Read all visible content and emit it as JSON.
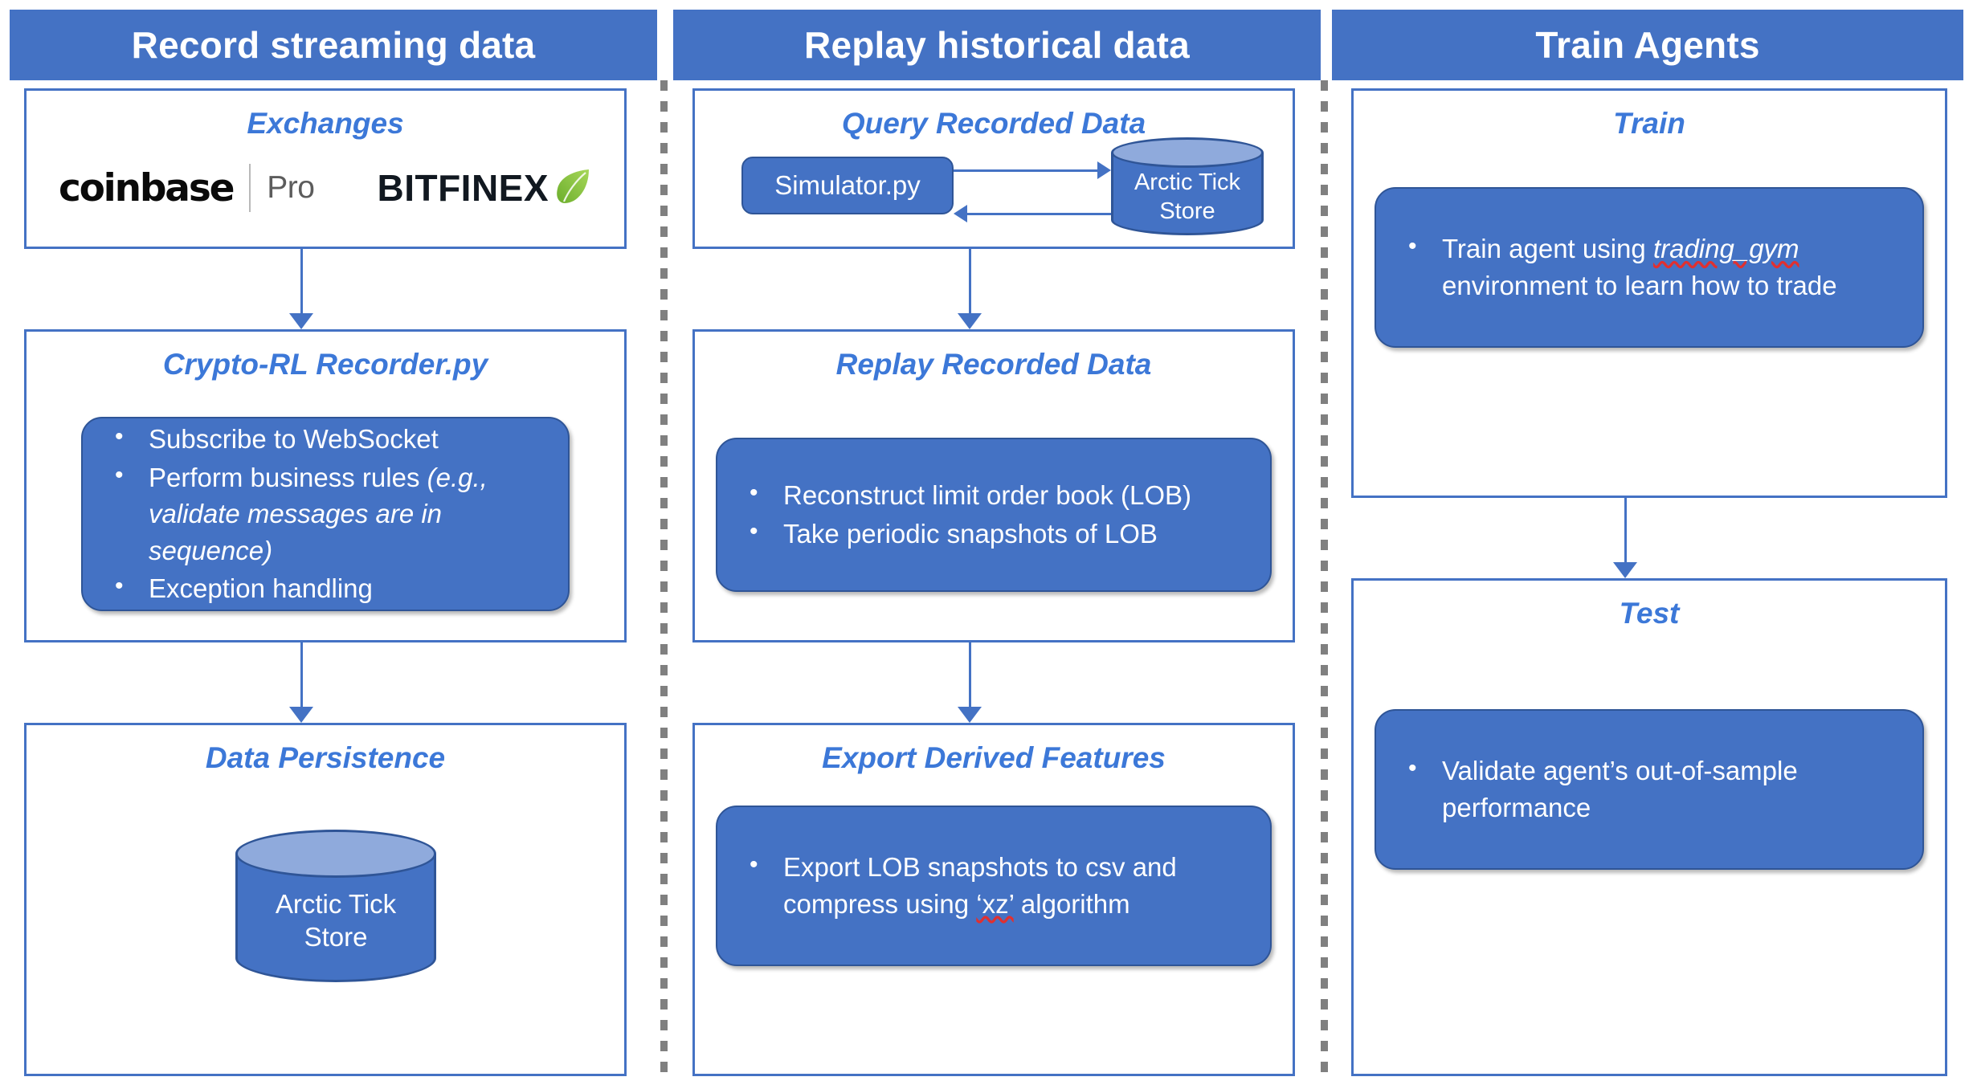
{
  "columns": [
    {
      "header": "Record streaming data",
      "stages": [
        {
          "title": "Exchanges",
          "logos": [
            {
              "name": "coinbase-pro",
              "word": "coinbase",
              "sub": "Pro"
            },
            {
              "name": "bitfinex",
              "word": "BITFINEX"
            }
          ]
        },
        {
          "title": "Crypto-RL Recorder.py",
          "bullets": [
            {
              "text": "Subscribe to WebSocket"
            },
            {
              "text": "Perform business rules ",
              "italic_tail": "(e.g., validate messages are in sequence)"
            },
            {
              "text": "Exception handling"
            }
          ]
        },
        {
          "title": "Data Persistence",
          "cylinder": {
            "line1": "Arctic Tick",
            "line2": "Store"
          }
        }
      ]
    },
    {
      "header": "Replay historical data",
      "stages": [
        {
          "title": "Query Recorded Data",
          "simulator": "Simulator.py",
          "cylinder": {
            "line1": "Arctic Tick",
            "line2": "Store"
          }
        },
        {
          "title": "Replay Recorded Data",
          "bullets": [
            {
              "text": "Reconstruct limit order book (LOB)"
            },
            {
              "text": "Take periodic snapshots of LOB"
            }
          ]
        },
        {
          "title": "Export Derived Features",
          "bullets": [
            {
              "text": "Export LOB snapshots to csv and compress using ",
              "squiggle": "‘xz’",
              "tail": " algorithm"
            }
          ]
        }
      ]
    },
    {
      "header": "Train Agents",
      "stages": [
        {
          "title": "Train",
          "bullets": [
            {
              "text": "Train agent using ",
              "squiggle_italic": "trading_gym",
              "tail": " environment to learn how to trade"
            }
          ]
        },
        {
          "title": "Test",
          "bullets": [
            {
              "text": "Validate agent’s out-of-sample performance"
            }
          ]
        }
      ]
    }
  ],
  "colors": {
    "header_bg": "#4472C4",
    "panel_border": "#4472C4",
    "title_text": "#3C78D8",
    "card_bg": "#4472C4",
    "card_border": "#2F5597",
    "cylinder_top": "#8FAADC",
    "divider": "#808080",
    "spellcheck": "#E03030",
    "leaf_green": "#8DC63F"
  }
}
